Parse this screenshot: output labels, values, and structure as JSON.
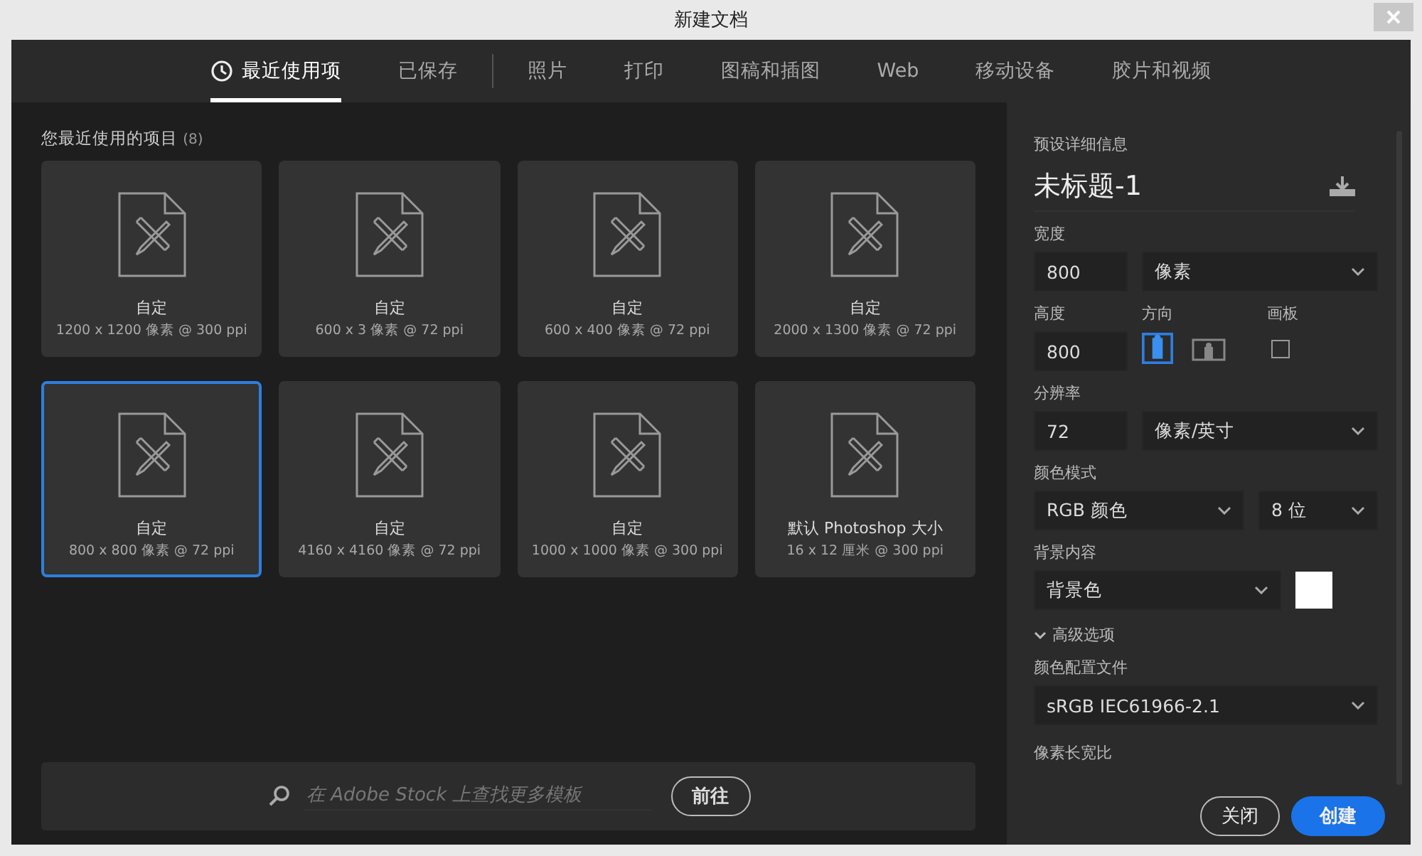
{
  "window": {
    "title": "新建文档"
  },
  "tab_groups": [
    [
      {
        "kind": "recent",
        "label": "最近使用项",
        "selected": true
      },
      {
        "kind": "plain",
        "label": "已保存",
        "selected": false
      }
    ],
    [
      {
        "kind": "plain",
        "label": "照片",
        "selected": false
      },
      {
        "kind": "plain",
        "label": "打印",
        "selected": false
      },
      {
        "kind": "plain",
        "label": "图稿和插图",
        "selected": false
      },
      {
        "kind": "plain",
        "label": "Web",
        "selected": false
      },
      {
        "kind": "plain",
        "label": "移动设备",
        "selected": false
      },
      {
        "kind": "plain",
        "label": "胶片和视频",
        "selected": false
      }
    ]
  ],
  "recent": {
    "heading": "您最近使用的项目",
    "count": "(8)",
    "presets": [
      {
        "name": "自定",
        "size": "1200 x 1200 像素 @ 300 ppi",
        "selected": false
      },
      {
        "name": "自定",
        "size": "600 x 3 像素 @ 72 ppi",
        "selected": false
      },
      {
        "name": "自定",
        "size": "600 x 400 像素 @ 72 ppi",
        "selected": false
      },
      {
        "name": "自定",
        "size": "2000 x 1300 像素 @ 72 ppi",
        "selected": false
      },
      {
        "name": "自定",
        "size": "800 x 800 像素 @ 72 ppi",
        "selected": true
      },
      {
        "name": "自定",
        "size": "4160 x 4160 像素 @ 72 ppi",
        "selected": false
      },
      {
        "name": "自定",
        "size": "1000 x 1000 像素 @ 300 ppi",
        "selected": false
      },
      {
        "name": "默认 Photoshop 大小",
        "size": "16 x 12 厘米 @ 300 ppi",
        "selected": false
      }
    ]
  },
  "stock": {
    "placeholder": "在 Adobe Stock 上查找更多模板",
    "button": "前往"
  },
  "details": {
    "heading": "预设详细信息",
    "doc_name": "未标题-1",
    "width": {
      "label": "宽度",
      "value": "800",
      "unit": "像素"
    },
    "height": {
      "label": "高度",
      "value": "800"
    },
    "orientation": {
      "label": "方向",
      "options": [
        {
          "kind": "portrait",
          "selected": true
        },
        {
          "kind": "landscape",
          "selected": false
        }
      ]
    },
    "artboard": {
      "label": "画板",
      "checked": false
    },
    "resolution": {
      "label": "分辨率",
      "value": "72",
      "unit": "像素/英寸"
    },
    "color_mode": {
      "label": "颜色模式",
      "mode": "RGB 颜色",
      "depth": "8 位"
    },
    "background": {
      "label": "背景内容",
      "value": "背景色",
      "color": "#ffffff"
    },
    "advanced": {
      "label": "高级选项",
      "expanded": true
    },
    "color_profile": {
      "label": "颜色配置文件",
      "value": "sRGB IEC61966-2.1"
    },
    "pixel_aspect": {
      "label": "像素长宽比"
    }
  },
  "buttons": {
    "close": "关闭",
    "create": "创建"
  }
}
